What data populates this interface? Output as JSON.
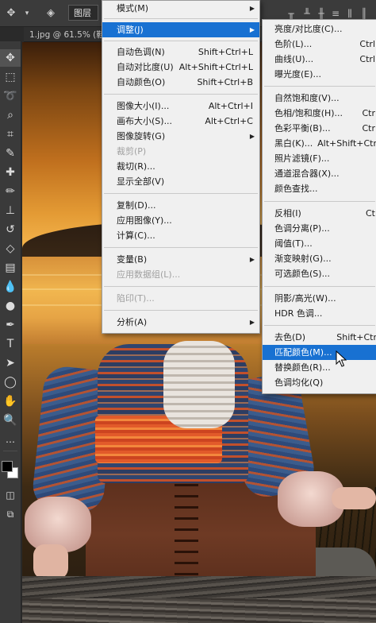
{
  "optbar": {
    "layer_field": "图层",
    "icons": [
      "chevron-down-icon",
      "auto-select-icon"
    ]
  },
  "doc_tab": {
    "title": "1.jpg @ 61.5% (鞋"
  },
  "image_menu": {
    "items": [
      {
        "label": "模式(M)",
        "shortcut": "",
        "submenu": true,
        "disabled": false
      },
      {
        "label": "调整(J)",
        "shortcut": "",
        "submenu": true,
        "disabled": false,
        "highlighted": true
      },
      {
        "label": "自动色调(N)",
        "shortcut": "Shift+Ctrl+L"
      },
      {
        "label": "自动对比度(U)",
        "shortcut": "Alt+Shift+Ctrl+L"
      },
      {
        "label": "自动颜色(O)",
        "shortcut": "Shift+Ctrl+B"
      },
      {
        "label": "图像大小(I)...",
        "shortcut": "Alt+Ctrl+I"
      },
      {
        "label": "画布大小(S)...",
        "shortcut": "Alt+Ctrl+C"
      },
      {
        "label": "图像旋转(G)",
        "shortcut": "",
        "submenu": true
      },
      {
        "label": "裁剪(P)",
        "shortcut": "",
        "disabled": true
      },
      {
        "label": "裁切(R)...",
        "shortcut": ""
      },
      {
        "label": "显示全部(V)",
        "shortcut": ""
      },
      {
        "label": "复制(D)...",
        "shortcut": ""
      },
      {
        "label": "应用图像(Y)...",
        "shortcut": ""
      },
      {
        "label": "计算(C)...",
        "shortcut": ""
      },
      {
        "label": "变量(B)",
        "shortcut": "",
        "submenu": true
      },
      {
        "label": "应用数据组(L)...",
        "shortcut": "",
        "disabled": true
      },
      {
        "label": "陷印(T)...",
        "shortcut": "",
        "disabled": true
      },
      {
        "label": "分析(A)",
        "shortcut": "",
        "submenu": true
      }
    ]
  },
  "adjust_menu": {
    "items": [
      {
        "label": "亮度/对比度(C)...",
        "shortcut": ""
      },
      {
        "label": "色阶(L)...",
        "shortcut": "Ctrl"
      },
      {
        "label": "曲线(U)...",
        "shortcut": "Ctrl"
      },
      {
        "label": "曝光度(E)...",
        "shortcut": ""
      },
      {
        "label": "自然饱和度(V)...",
        "shortcut": ""
      },
      {
        "label": "色相/饱和度(H)...",
        "shortcut": "Ctr"
      },
      {
        "label": "色彩平衡(B)...",
        "shortcut": "Ctr"
      },
      {
        "label": "黑白(K)...",
        "shortcut": "Alt+Shift+Ctr"
      },
      {
        "label": "照片滤镜(F)...",
        "shortcut": ""
      },
      {
        "label": "通道混合器(X)...",
        "shortcut": ""
      },
      {
        "label": "颜色查找...",
        "shortcut": ""
      },
      {
        "label": "反相(I)",
        "shortcut": "Ct"
      },
      {
        "label": "色调分离(P)...",
        "shortcut": ""
      },
      {
        "label": "阈值(T)...",
        "shortcut": ""
      },
      {
        "label": "渐变映射(G)...",
        "shortcut": ""
      },
      {
        "label": "可选颜色(S)...",
        "shortcut": ""
      },
      {
        "label": "阴影/高光(W)...",
        "shortcut": ""
      },
      {
        "label": "HDR 色调...",
        "shortcut": ""
      },
      {
        "label": "去色(D)",
        "shortcut": "Shift+Ctr"
      },
      {
        "label": "匹配颜色(M)...",
        "shortcut": "",
        "highlighted": true
      },
      {
        "label": "替换颜色(R)...",
        "shortcut": ""
      },
      {
        "label": "色调均化(Q)",
        "shortcut": ""
      }
    ]
  },
  "colors": {
    "menu_bg": "#f0f0f0",
    "highlight": "#1871d2",
    "panel_bg": "#3a3a3a"
  }
}
